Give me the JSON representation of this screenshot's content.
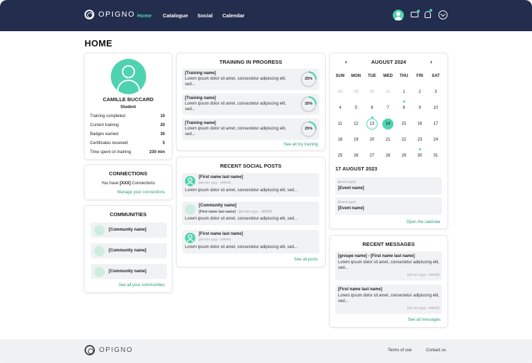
{
  "brand": {
    "name": "OPIGNO",
    "accent": "#4ed3ae",
    "header_bg": "#232d4e"
  },
  "nav": {
    "items": [
      "Home",
      "Catalogue",
      "Social",
      "Calendar"
    ],
    "active": "Home"
  },
  "header_icons": [
    "avatar",
    "mail-icon",
    "bell-icon",
    "chevron-down-icon"
  ],
  "page_title": "HOME",
  "profile": {
    "name": "CAMILLE BUCCARD",
    "role": "Student",
    "stats": [
      {
        "label": "Training completed",
        "value": "10"
      },
      {
        "label": "Current training",
        "value": "20"
      },
      {
        "label": "Badges earned",
        "value": "30"
      },
      {
        "label": "Certificates received",
        "value": "5"
      },
      {
        "label": "Time spent on training",
        "value": "230 min"
      }
    ]
  },
  "connections": {
    "title": "CONNECTIONS",
    "text_prefix": "You have",
    "count": "[XXX]",
    "text_suffix": "Connections",
    "link": "Manage your connections"
  },
  "communities": {
    "title": "COMMUNITIES",
    "items": [
      "[Community name]",
      "[Community name]",
      "[Community name]"
    ],
    "link": "See all your communities"
  },
  "training": {
    "title": "TRAINING IN PROGRESS",
    "items": [
      {
        "name": "[Training name]",
        "desc": "Lorem ipsum dolor sit amet, consectetur adipiscing elit, sed...",
        "progress": "25%",
        "progress_value": 0.25
      },
      {
        "name": "[Training name]",
        "desc": "Lorem ipsum dolor sit amet, consectetur adipiscing elit, sed...",
        "progress": "25%",
        "progress_value": 0.25
      },
      {
        "name": "[Training name]",
        "desc": "Lorem ipsum dolor sit amet, consectetur adipiscing elit, sed...",
        "progress": "25%",
        "progress_value": 0.25
      }
    ],
    "link": "See all my training"
  },
  "social": {
    "title": "RECENT SOCIAL POSTS",
    "posts": [
      {
        "author": "[First name  last name]",
        "community": "",
        "date": "[dd mm yyyy - 00h00]",
        "text": "Lorem ipsum dolor sit amet, consectetur adipiscing elit, sed...",
        "avatar": "user"
      },
      {
        "author": "[Community name]",
        "community": "[First name  last name]",
        "date": "[dd mm yyyy - 00h00]",
        "text": "Lorem ipsum dolor sit amet, consectetur adipiscing elit, sed...",
        "avatar": "community"
      },
      {
        "author": "[First name  last name]",
        "community": "",
        "date": "[dd mm yyyy - 00h00]",
        "text": "Lorem ipsum dolor sit amet, consectetur adipiscing elit, sed...",
        "avatar": "user"
      }
    ],
    "link": "See all posts"
  },
  "calendar": {
    "month": "AUGUST 2024",
    "weekdays": [
      "SUN",
      "MON",
      "TUE",
      "WED",
      "THU",
      "FRI",
      "SAT"
    ],
    "weeks": [
      [
        {
          "d": "28",
          "m": 1
        },
        {
          "d": "29",
          "m": 1
        },
        {
          "d": "30",
          "m": 1
        },
        {
          "d": "31",
          "m": 1
        },
        {
          "d": "1"
        },
        {
          "d": "2"
        },
        {
          "d": "3"
        }
      ],
      [
        {
          "d": "4"
        },
        {
          "d": "5"
        },
        {
          "d": "6"
        },
        {
          "d": "7"
        },
        {
          "d": "8",
          "ev": 1
        },
        {
          "d": "9"
        },
        {
          "d": "10"
        }
      ],
      [
        {
          "d": "11"
        },
        {
          "d": "12"
        },
        {
          "d": "13",
          "ring": 1,
          "ev": 1
        },
        {
          "d": "14",
          "sel": 1
        },
        {
          "d": "15"
        },
        {
          "d": "16"
        },
        {
          "d": "17"
        }
      ],
      [
        {
          "d": "18"
        },
        {
          "d": "19"
        },
        {
          "d": "20"
        },
        {
          "d": "21"
        },
        {
          "d": "22"
        },
        {
          "d": "23"
        },
        {
          "d": "24"
        }
      ],
      [
        {
          "d": "25"
        },
        {
          "d": "26"
        },
        {
          "d": "27"
        },
        {
          "d": "28"
        },
        {
          "d": "29"
        },
        {
          "d": "30",
          "ev": 1
        },
        {
          "d": "31"
        }
      ]
    ],
    "selected_date": "17 AUGUST 2023",
    "events": [
      {
        "type": "[Event type]",
        "name": "[Event name]"
      },
      {
        "type": "[Event type]",
        "name": "[Event name]"
      }
    ],
    "link": "Open the calendar"
  },
  "messages": {
    "title": "RECENT MESSAGES",
    "items": [
      {
        "from": "[groupe name]  -  [First name  last name]",
        "text": "Lorem ipsum dolor sit amet, consectetur adipiscing elit, sed...",
        "date": "[dd mm yyyy - 00h00]"
      },
      {
        "from": "[First name  last name]",
        "text": "Lorem ipsum dolor sit amet, consectetur adipiscing elit, sed...",
        "date": "[dd mm yyyy - 00h00]"
      }
    ],
    "link": "See all messages"
  },
  "footer": {
    "brand": "OPIGNO",
    "links": [
      "Terms of use",
      "Contact us"
    ]
  }
}
